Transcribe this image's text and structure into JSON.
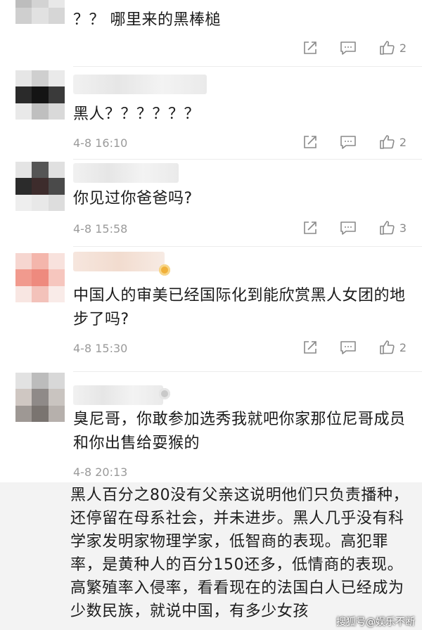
{
  "comments": [
    {
      "text": "？？ 哪里来的黑棒槌",
      "time": "",
      "likes": "2"
    },
    {
      "text": "黑人？？？？？？",
      "time": "4-8 16:10",
      "likes": "2"
    },
    {
      "text": "你见过你爸爸吗?",
      "time": "4-8 15:58",
      "likes": "3"
    },
    {
      "text": "中国人的审美已经国际化到能欣赏黑人女团的地步了吗?",
      "time": "4-8 15:30",
      "likes": "2"
    },
    {
      "text": "臭尼哥，你敢参加选秀我就吧你家那位尼哥成员和你出售给耍猴的",
      "time": "4-8 20:13",
      "likes": ""
    }
  ],
  "quoted_comment": {
    "text": "黑人百分之80没有父亲这说明他们只负责播种，还停留在母系社会，并未进步。黑人几乎没有科学家发明家物理学家，低智商的表现。高犯罪率，是黄种人的百分150还多，低情商的表现。高繁殖率入侵率，看看现在的法国白人已经成为少数民族，就说中国，有多少女孩"
  },
  "watermark": "搜狐号@娱乐不断",
  "icons": {
    "share": "share-icon",
    "reply": "reply-icon",
    "like": "thumbs-up-icon"
  }
}
